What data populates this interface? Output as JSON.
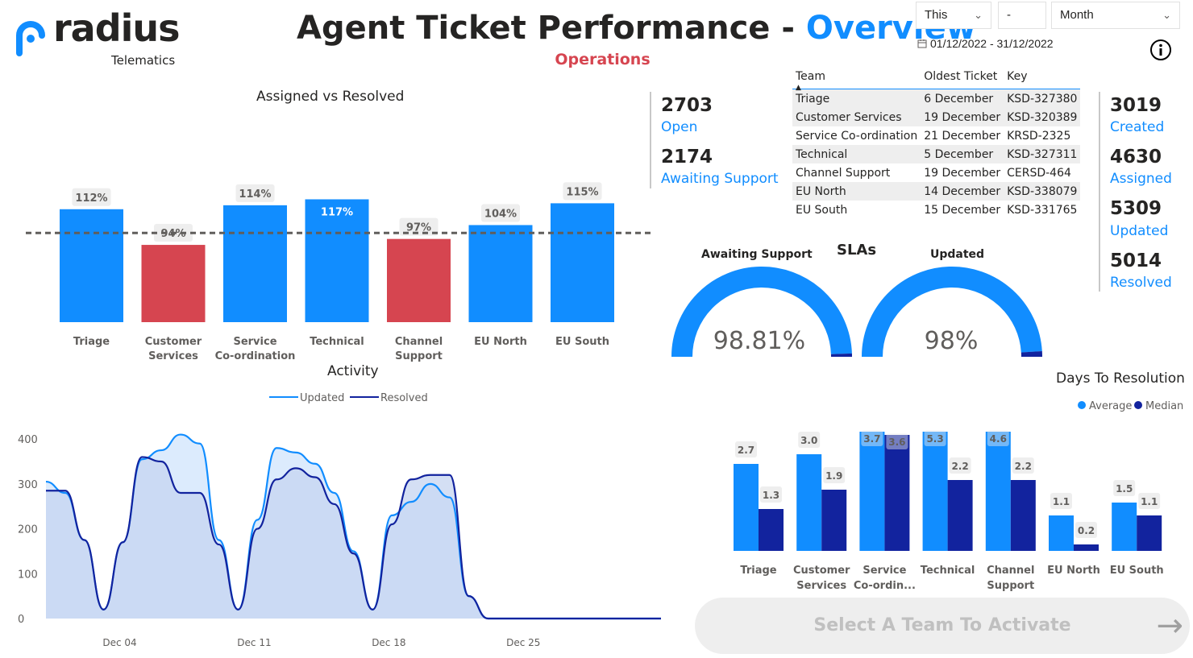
{
  "brand": {
    "name": "radius",
    "tagline": "Telematics",
    "color": "#118dff"
  },
  "title": {
    "main": "Agent Ticket Performance - ",
    "accent": "Overview",
    "subtitle": "Operations"
  },
  "filters": {
    "period": "This",
    "count": "-",
    "unit": "Month",
    "date_range": "01/12/2022 - 31/12/2022"
  },
  "kpis_left": [
    {
      "value": "2703",
      "label": "Open"
    },
    {
      "value": "2174",
      "label": "Awaiting Support"
    }
  ],
  "kpis_right": [
    {
      "value": "3019",
      "label": "Created"
    },
    {
      "value": "4630",
      "label": "Assigned"
    },
    {
      "value": "5309",
      "label": "Updated"
    },
    {
      "value": "5014",
      "label": "Resolved"
    }
  ],
  "table": {
    "columns": [
      "Team",
      "Oldest Ticket",
      "Key"
    ],
    "rows": [
      [
        "Triage",
        "6 December",
        "KSD-327380"
      ],
      [
        "Customer Services",
        "19 December",
        "KSD-320389"
      ],
      [
        "Service Co-ordination",
        "21 December",
        "KRSD-2325"
      ],
      [
        "Technical",
        "5 December",
        "KSD-327311"
      ],
      [
        "Channel Support",
        "19 December",
        "CERSD-464"
      ],
      [
        "EU North",
        "14 December",
        "KSD-338079"
      ],
      [
        "EU South",
        "15 December",
        "KSD-331765"
      ]
    ]
  },
  "slas": {
    "title": "SLAs",
    "gauges": [
      {
        "label": "Awaiting Support",
        "display": "98.81%",
        "value": 0.9881
      },
      {
        "label": "Updated",
        "display": "98%",
        "value": 0.98
      }
    ]
  },
  "cta": {
    "label": "Select A Team To Activate"
  },
  "colors": {
    "blue": "#118dff",
    "navy": "#12239e",
    "red": "#d64550"
  },
  "chart_data": [
    {
      "type": "bar",
      "title": "Assigned vs Resolved",
      "categories": [
        [
          "Triage"
        ],
        [
          "Customer",
          "Services"
        ],
        [
          "Service",
          "Co-ordination"
        ],
        [
          "Technical"
        ],
        [
          "Channel",
          "Support"
        ],
        [
          "EU North"
        ],
        [
          "EU South"
        ]
      ],
      "values": [
        112,
        94,
        114,
        117,
        97,
        104,
        115
      ],
      "labels": [
        "112%",
        "94%",
        "114%",
        "117%",
        "97%",
        "104%",
        "115%"
      ],
      "reference_line": 100,
      "below_reference_color": "#d64550",
      "bar_color": "#118dff"
    },
    {
      "type": "area",
      "title": "Activity",
      "series": [
        {
          "name": "Updated",
          "color": "#118dff",
          "values": [
            305,
            280,
            175,
            20,
            170,
            355,
            375,
            410,
            390,
            175,
            20,
            220,
            380,
            370,
            345,
            280,
            150,
            20,
            230,
            260,
            300,
            270,
            50,
            0,
            0,
            0,
            0,
            0,
            0,
            0,
            0,
            0,
            0
          ]
        },
        {
          "name": "Resolved",
          "color": "#12239e",
          "values": [
            285,
            285,
            175,
            20,
            170,
            360,
            350,
            280,
            280,
            165,
            20,
            200,
            310,
            335,
            315,
            255,
            145,
            20,
            210,
            310,
            320,
            320,
            50,
            0,
            0,
            0,
            0,
            0,
            0,
            0,
            0,
            0,
            0
          ]
        }
      ],
      "x_start_day": 1,
      "x_ticks": [
        "Dec 04",
        "Dec 11",
        "Dec 18",
        "Dec 25"
      ],
      "x_tick_days": [
        4,
        11,
        18,
        25
      ],
      "y_ticks": [
        0,
        100,
        200,
        300,
        400
      ],
      "ylim": [
        0,
        420
      ],
      "legend_position": "top-center"
    },
    {
      "type": "bar",
      "title": "Days To Resolution",
      "categories": [
        [
          "Triage"
        ],
        [
          "Customer",
          "Services"
        ],
        [
          "Service",
          "Co-ordin..."
        ],
        [
          "Technical"
        ],
        [
          "Channel",
          "Support"
        ],
        [
          "EU North"
        ],
        [
          "EU South"
        ]
      ],
      "series": [
        {
          "name": "Average",
          "color": "#118dff",
          "values": [
            2.7,
            3.0,
            3.7,
            5.3,
            4.6,
            1.1,
            1.5
          ]
        },
        {
          "name": "Median",
          "color": "#12239e",
          "values": [
            1.3,
            1.9,
            3.6,
            2.2,
            2.2,
            0.2,
            1.1
          ]
        }
      ],
      "ylim": [
        0,
        3.7
      ],
      "legend_position": "top-right"
    }
  ]
}
